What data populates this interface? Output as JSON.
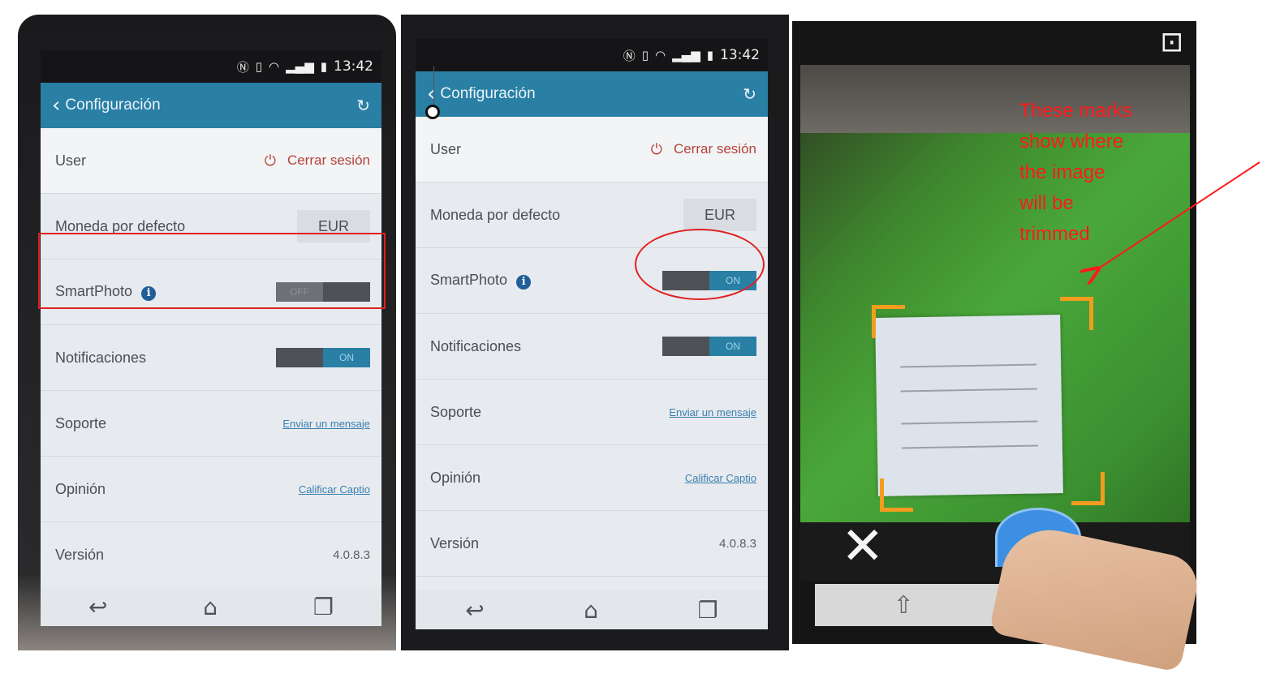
{
  "statusbar": {
    "time": "13:42"
  },
  "settings": {
    "title": "Configuración",
    "user_label": "User",
    "logout_label": "Cerrar sesión",
    "currency_label": "Moneda por defecto",
    "currency_value": "EUR",
    "smartphoto_label": "SmartPhoto",
    "notifications_label": "Notificaciones",
    "support_label": "Soporte",
    "support_link": "Enviar un mensaje",
    "opinion_label": "Opinión",
    "opinion_link": "Calificar Captio",
    "version_label": "Versión",
    "version_value": "4.0.8.3"
  },
  "phone1": {
    "smartphoto_toggle": "OFF",
    "notifications_toggle": "ON"
  },
  "phone2": {
    "smartphoto_toggle": "ON",
    "notifications_toggle": "ON"
  },
  "annotation": {
    "lines": [
      "These marks",
      "show where",
      "the image",
      "will be",
      "trimmed"
    ],
    "color": "#ff1a1a"
  },
  "icons": [
    "back-chevron-icon",
    "sync-icon",
    "power-icon",
    "info-icon",
    "back-icon",
    "home-icon",
    "recents-icon",
    "close-icon",
    "shutter-button",
    "crop-icon",
    "share-icon"
  ]
}
